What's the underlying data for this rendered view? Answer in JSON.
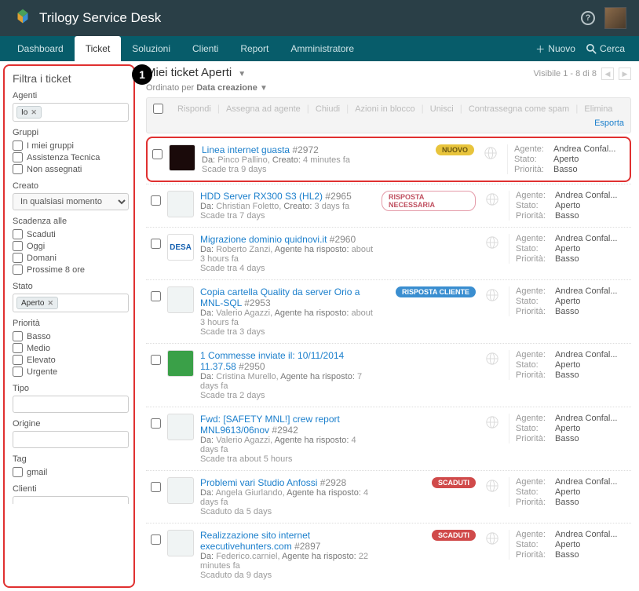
{
  "header": {
    "title": "Trilogy Service Desk"
  },
  "nav": {
    "items": [
      "Dashboard",
      "Ticket",
      "Soluzioni",
      "Clienti",
      "Report",
      "Amministratore"
    ],
    "active_index": 1,
    "new_btn": "Nuovo",
    "search_btn": "Cerca"
  },
  "sidebar": {
    "title": "Filtra i ticket",
    "badge_number": "1",
    "agents_label": "Agenti",
    "agents_selected": "Io",
    "groups_label": "Gruppi",
    "groups": [
      "I miei gruppi",
      "Assistenza Tecnica",
      "Non assegnati"
    ],
    "created_label": "Creato",
    "created_value": "In qualsiasi momento",
    "due_label": "Scadenza alle",
    "due_opts": [
      "Scaduti",
      "Oggi",
      "Domani",
      "Prossime 8 ore"
    ],
    "state_label": "Stato",
    "state_selected": "Aperto",
    "priority_label": "Priorità",
    "priority_opts": [
      "Basso",
      "Medio",
      "Elevato",
      "Urgente"
    ],
    "type_label": "Tipo",
    "origin_label": "Origine",
    "tag_label": "Tag",
    "tag_opts": [
      "gmail"
    ],
    "clients_label": "Clienti"
  },
  "main": {
    "view_title": "Miei ticket Aperti",
    "sort_prefix": "Ordinato per",
    "sort_field": "Data creazione",
    "paging_text": "Visibile 1 - 8 di 8",
    "bulk_actions": [
      "Rispondi",
      "Assegna ad agente",
      "Chiudi",
      "Azioni in blocco",
      "Unisci",
      "Contrassegna come spam",
      "Elimina"
    ],
    "export_label": "Esporta",
    "status_keys": {
      "agent": "Agente:",
      "state": "Stato:",
      "priority": "Priorità:"
    },
    "tickets": [
      {
        "title": "Linea internet guasta",
        "num": "#2972",
        "by": "Pinco Pallino",
        "meta_label": "Creato:",
        "meta_val": "4 minutes fa",
        "due": "Scade tra 9 days",
        "badge": "NUOVO",
        "badge_cls": "b-new",
        "agent": "Andrea Confal...",
        "state": "Aperto",
        "priority": "Basso",
        "hl": true,
        "thumb": "thumb-a",
        "thumb_txt": ""
      },
      {
        "title": "HDD Server RX300 S3 (HL2)",
        "num": "#2965",
        "by": "Christian Foletto",
        "meta_label": "Creato:",
        "meta_val": "3 days fa",
        "due": "Scade tra 7 days",
        "badge": "RISPOSTA NECESSARIA",
        "badge_cls": "b-resp",
        "agent": "Andrea Confal...",
        "state": "Aperto",
        "priority": "Basso",
        "hl": false,
        "thumb": "thumb-b",
        "thumb_txt": ""
      },
      {
        "title": "Migrazione dominio quidnovi.it",
        "num": "#2960",
        "by": "Roberto Zanzi",
        "meta_label": "Agente ha risposto:",
        "meta_val": "about 3 hours fa",
        "due": "Scade tra 4 days",
        "badge": "",
        "badge_cls": "",
        "agent": "Andrea Confal...",
        "state": "Aperto",
        "priority": "Basso",
        "hl": false,
        "thumb": "thumb-desa",
        "thumb_txt": "DESA"
      },
      {
        "title": "Copia cartella Quality da server Orio a MNL-SQL",
        "num": "#2953",
        "by": "Valerio Agazzi",
        "meta_label": "Agente ha risposto:",
        "meta_val": "about 3 hours fa",
        "due": "Scade tra 3 days",
        "badge": "RISPOSTA CLIENTE",
        "badge_cls": "b-client",
        "agent": "Andrea Confal...",
        "state": "Aperto",
        "priority": "Basso",
        "hl": false,
        "thumb": "thumb-b",
        "thumb_txt": ""
      },
      {
        "title": "1 Commesse inviate il: 10/11/2014 11.37.58",
        "num": "#2950",
        "by": "Cristina Murello",
        "meta_label": "Agente ha risposto:",
        "meta_val": "7 days fa",
        "due": "Scade tra 2 days",
        "badge": "",
        "badge_cls": "",
        "agent": "Andrea Confal...",
        "state": "Aperto",
        "priority": "Basso",
        "hl": false,
        "thumb": "thumb-green",
        "thumb_txt": ""
      },
      {
        "title": "Fwd: [SAFETY MNL!] crew report MNL9613/06nov",
        "num": "#2942",
        "by": "Valerio Agazzi",
        "meta_label": "Agente ha risposto:",
        "meta_val": "4 days fa",
        "due": "Scade tra about 5 hours",
        "badge": "",
        "badge_cls": "",
        "agent": "Andrea Confal...",
        "state": "Aperto",
        "priority": "Basso",
        "hl": false,
        "thumb": "thumb-b",
        "thumb_txt": ""
      },
      {
        "title": "Problemi vari Studio Anfossi",
        "num": "#2928",
        "by": "Angela Giurlando",
        "meta_label": "Agente ha risposto:",
        "meta_val": "4 days fa",
        "due": "Scaduto da 5 days",
        "badge": "SCADUTI",
        "badge_cls": "b-over",
        "agent": "Andrea Confal...",
        "state": "Aperto",
        "priority": "Basso",
        "hl": false,
        "thumb": "thumb-b",
        "thumb_txt": ""
      },
      {
        "title": "Realizzazione sito internet executivehunters.com",
        "num": "#2897",
        "by": "Federico.carniel",
        "meta_label": "Agente ha risposto:",
        "meta_val": "22 minutes fa",
        "due": "Scaduto da 9 days",
        "badge": "SCADUTI",
        "badge_cls": "b-over",
        "agent": "Andrea Confal...",
        "state": "Aperto",
        "priority": "Basso",
        "hl": false,
        "thumb": "thumb-b",
        "thumb_txt": ""
      }
    ]
  }
}
